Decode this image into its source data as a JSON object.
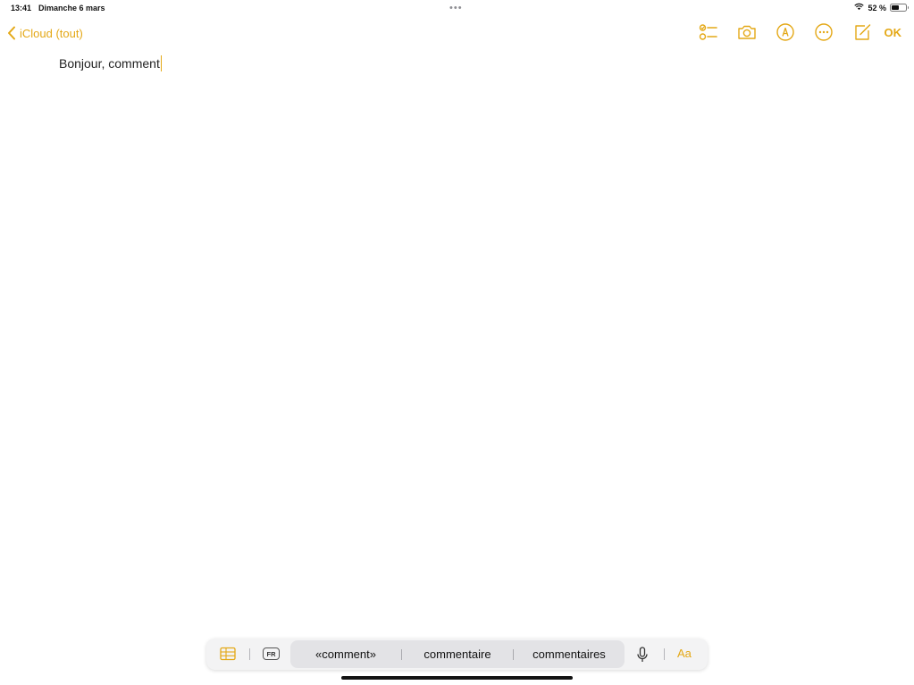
{
  "status_bar": {
    "time": "13:41",
    "date": "Dimanche 6 mars",
    "multitask": "•••",
    "battery_percent": "52 %",
    "battery_level": 0.52
  },
  "nav": {
    "back_label": "iCloud (tout)",
    "done_label": "OK"
  },
  "toolbar_icons": [
    "checklist-icon",
    "camera-icon",
    "markup-icon",
    "more-icon",
    "compose-icon"
  ],
  "note": {
    "text": "Bonjour, comment"
  },
  "shortcut_bar": {
    "language": "FR",
    "predictions": [
      "«comment»",
      "commentaire",
      "commentaires"
    ],
    "format_label": "Aa"
  },
  "colors": {
    "accent": "#e4a816",
    "background": "#ffffff",
    "bar_background": "#f3f3f4"
  }
}
